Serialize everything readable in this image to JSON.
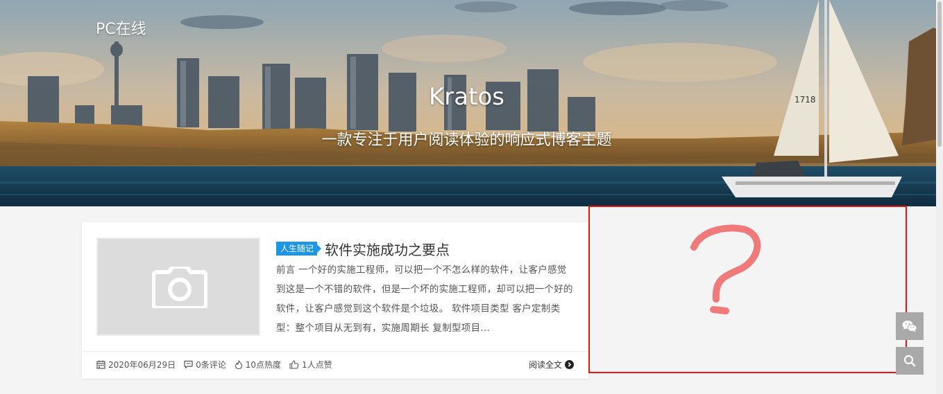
{
  "header": {
    "site_title": "PC在线",
    "hero_title": "Kratos",
    "hero_subtitle": "一款专注于用户阅读体验的响应式博客主题",
    "sail_number": "1718"
  },
  "article": {
    "category": "人生随记",
    "title": "软件实施成功之要点",
    "excerpt": "前言 一个好的实施工程师，可以把一个不怎么样的软件，让客户感觉到这是一个不错的软件，但是一个坏的实施工程师，却可以把一个好的软件，让客户感觉到这个软件是个垃圾。 软件项目类型 客户定制类型：整个项目从无到有，实施周期长 复制型项目...",
    "thumbnail_icon": "camera-icon",
    "meta": {
      "date": "2020年06月29日",
      "comments": "0条评论",
      "views": "10点热度",
      "likes": "1人点赞"
    },
    "read_more": "阅读全文"
  },
  "annotation": {
    "color": "#e11111",
    "mark_color": "#f07a7a"
  },
  "floating_buttons": [
    {
      "icon": "wechat-icon"
    },
    {
      "icon": "search-icon"
    }
  ],
  "colors": {
    "tag_bg": "#1e96e6",
    "page_bg": "#f4f4f4",
    "float_btn_bg": "#a9a9a9"
  }
}
